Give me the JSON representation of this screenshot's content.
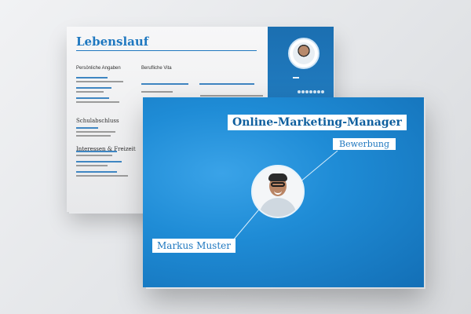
{
  "cv": {
    "title": "Lebenslauf",
    "sections": {
      "personal": "Persönliche Angaben",
      "career": "Berufliche Vita",
      "school": "Schulabschluss",
      "interests": "Interessen & Freizeit"
    }
  },
  "cover": {
    "job_title": "Online-Marketing-Manager",
    "label_application": "Bewerbung",
    "name": "Markus Muster"
  },
  "colors": {
    "accent": "#1f78c0",
    "accent_dark": "#0f5f9e"
  }
}
